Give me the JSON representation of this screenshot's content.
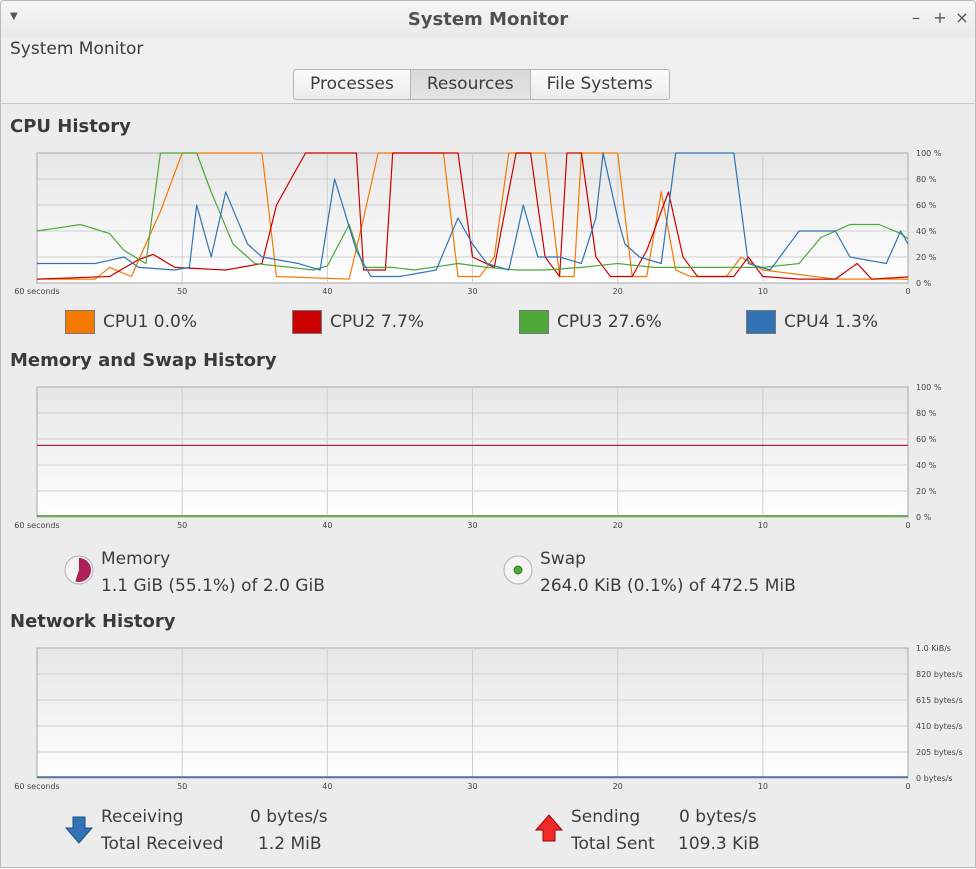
{
  "window": {
    "title": "System Monitor",
    "app_title": "System Monitor",
    "controls": [
      "–",
      "+",
      "×"
    ]
  },
  "tabs": [
    {
      "label": "Processes",
      "active": false
    },
    {
      "label": "Resources",
      "active": true
    },
    {
      "label": "File Systems",
      "active": false
    }
  ],
  "cpu": {
    "title": "CPU History",
    "x_ticks": [
      "60 seconds",
      "50",
      "40",
      "30",
      "20",
      "10",
      "0"
    ],
    "y_ticks": [
      "100 %",
      "80 %",
      "60 %",
      "40 %",
      "20 %",
      "0 %"
    ],
    "legend": [
      {
        "label": "CPU1 0.0%",
        "color": "#f57900"
      },
      {
        "label": "CPU2 7.7%",
        "color": "#cc0000"
      },
      {
        "label": "CPU3 27.6%",
        "color": "#4ea83a"
      },
      {
        "label": "CPU4 1.3%",
        "color": "#3173b5"
      }
    ]
  },
  "memory": {
    "title": "Memory and Swap History",
    "x_ticks": [
      "60 seconds",
      "50",
      "40",
      "30",
      "20",
      "10",
      "0"
    ],
    "y_ticks": [
      "100 %",
      "80 %",
      "60 %",
      "40 %",
      "20 %",
      "0 %"
    ],
    "memory_label": "Memory",
    "memory_value": "1.1 GiB (55.1%) of 2.0 GiB",
    "memory_color": "#ad1f58",
    "swap_label": "Swap",
    "swap_value": "264.0 KiB (0.1%) of 472.5 MiB",
    "swap_color": "#4ea83a"
  },
  "network": {
    "title": "Network History",
    "x_ticks": [
      "60 seconds",
      "50",
      "40",
      "30",
      "20",
      "10",
      "0"
    ],
    "y_ticks": [
      "1.0 KiB/s",
      "820 bytes/s",
      "615 bytes/s",
      "410 bytes/s",
      "205 bytes/s",
      "0 bytes/s"
    ],
    "receiving_label": "Receiving",
    "receiving_value": "0 bytes/s",
    "total_received_label": "Total Received",
    "total_received_value": "1.2 MiB",
    "sending_label": "Sending",
    "sending_value": "0 bytes/s",
    "total_sent_label": "Total Sent",
    "total_sent_value": "109.3 KiB",
    "receiving_color": "#3173b5",
    "sending_color": "#ef2929"
  }
}
